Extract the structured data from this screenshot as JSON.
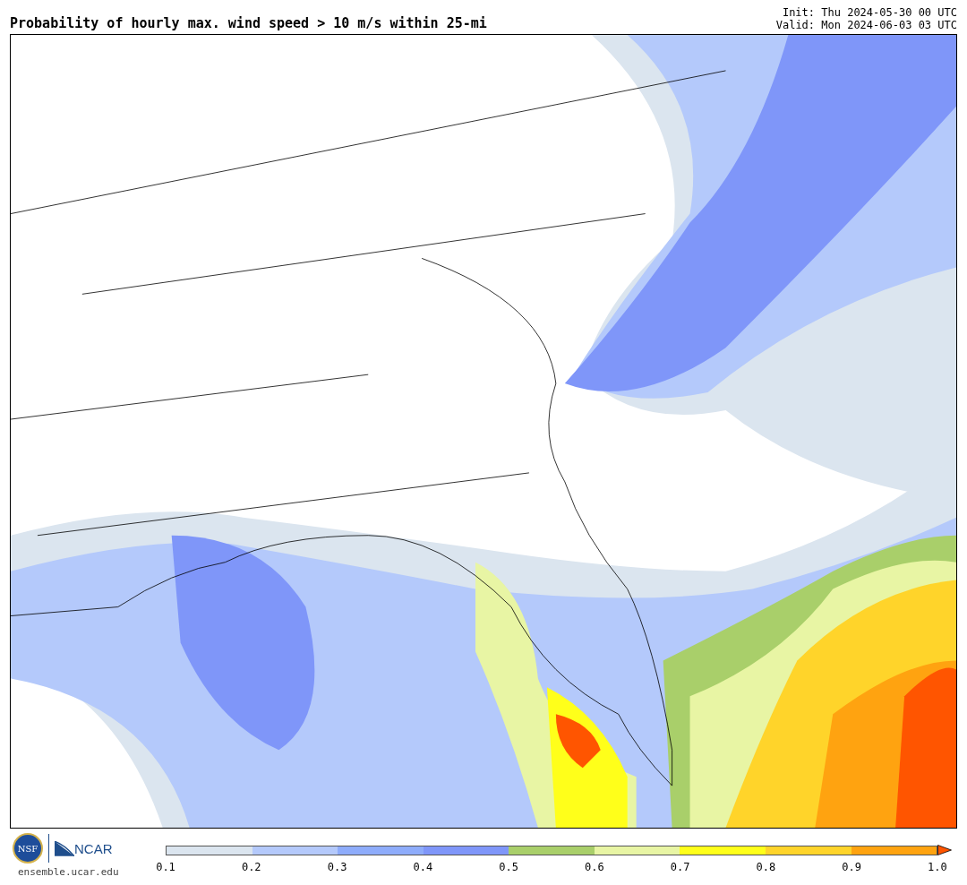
{
  "title": "Probability of hourly max. wind speed > 10 m/s within 25-mi",
  "init": "Init: Thu 2024-05-30 00 UTC",
  "valid": "Valid: Mon 2024-06-03 03 UTC",
  "logos": {
    "nsf": "NSF",
    "ncar": "NCAR",
    "url": "ensemble.ucar.edu"
  },
  "colorbar": {
    "bins": [
      {
        "color": "#dbe5ef"
      },
      {
        "color": "#b4c9fb"
      },
      {
        "color": "#8eacfb"
      },
      {
        "color": "#7f96f9"
      },
      {
        "color": "#a9cf6a"
      },
      {
        "color": "#e8f5a4"
      },
      {
        "color": "#ffff1a"
      },
      {
        "color": "#ffd42a"
      },
      {
        "color": "#ffa310"
      }
    ],
    "extension": {
      "color": "#ff5500"
    },
    "ticks": [
      "0.1",
      "0.2",
      "0.3",
      "0.4",
      "0.5",
      "0.6",
      "0.7",
      "0.8",
      "0.9",
      "1.0"
    ]
  }
}
